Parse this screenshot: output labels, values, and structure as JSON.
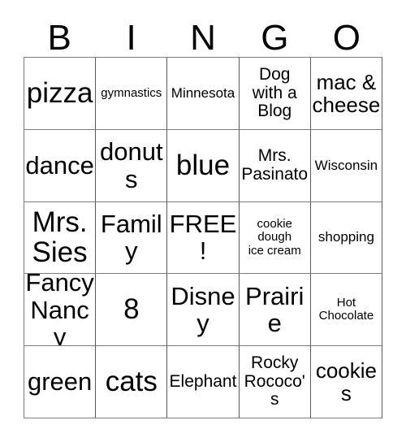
{
  "card": {
    "header_letters": [
      "B",
      "I",
      "N",
      "G",
      "O"
    ],
    "rows": [
      [
        {
          "text": "pizza",
          "size": "xl"
        },
        {
          "text": "gymnastics",
          "size": "xxs"
        },
        {
          "text": "Minnesota",
          "size": "xs"
        },
        {
          "text": "Dog\nwith a\nBlog",
          "size": "sm"
        },
        {
          "text": "mac &\ncheese",
          "size": "md"
        }
      ],
      [
        {
          "text": "dance",
          "size": "lg"
        },
        {
          "text": "donuts",
          "size": "lg"
        },
        {
          "text": "blue",
          "size": "xl"
        },
        {
          "text": "Mrs.\nPasinato",
          "size": "sm"
        },
        {
          "text": "Wisconsin",
          "size": "xs"
        }
      ],
      [
        {
          "text": "Mrs.\nSies",
          "size": "xl"
        },
        {
          "text": "Family",
          "size": "lg"
        },
        {
          "text": "FREE!",
          "size": "lg"
        },
        {
          "text": "cookie\ndough\nice cream",
          "size": "xxs"
        },
        {
          "text": "shopping",
          "size": "xs"
        }
      ],
      [
        {
          "text": "Fancy\nNancy",
          "size": "lg"
        },
        {
          "text": "8",
          "size": "xl"
        },
        {
          "text": "Disney",
          "size": "lg"
        },
        {
          "text": "Prairie",
          "size": "lg"
        },
        {
          "text": "Hot\nChocolate",
          "size": "xxs"
        }
      ],
      [
        {
          "text": "green",
          "size": "lg"
        },
        {
          "text": "cats",
          "size": "xl"
        },
        {
          "text": "Elephant",
          "size": "sm"
        },
        {
          "text": "Rocky\nRococo's",
          "size": "sm"
        },
        {
          "text": "cookies",
          "size": "md"
        }
      ]
    ]
  },
  "colors": {
    "background": "#ffffff",
    "text": "#000000",
    "grid_line": "#7c7c7c"
  }
}
